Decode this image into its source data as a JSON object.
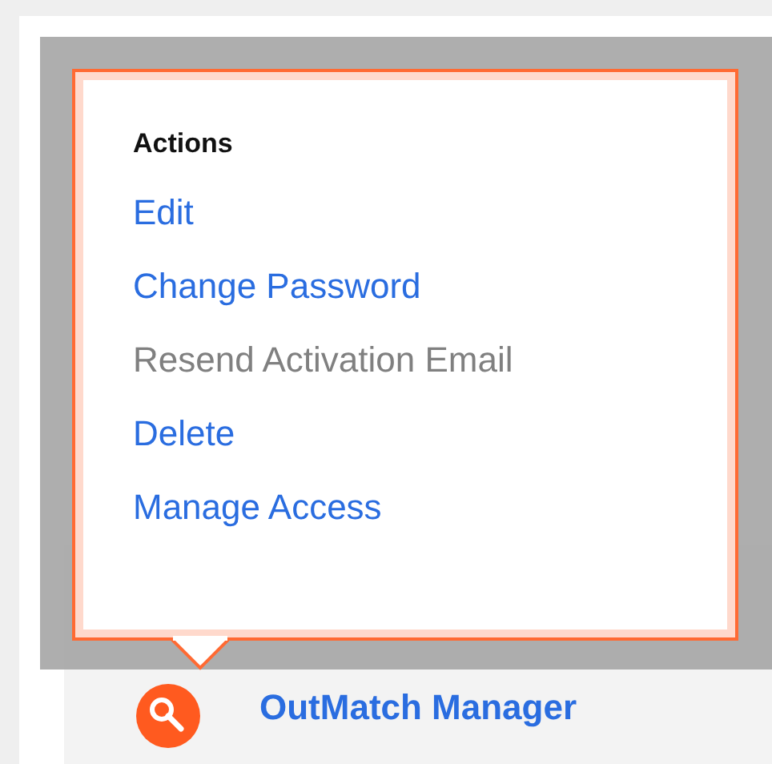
{
  "popup": {
    "title": "Actions",
    "items": [
      {
        "label": "Edit",
        "disabled": false
      },
      {
        "label": "Change Password",
        "disabled": false
      },
      {
        "label": "Resend Activation Email",
        "disabled": true
      },
      {
        "label": "Delete",
        "disabled": false
      },
      {
        "label": "Manage Access",
        "disabled": false
      }
    ]
  },
  "row": {
    "label": "OutMatch Manager"
  }
}
